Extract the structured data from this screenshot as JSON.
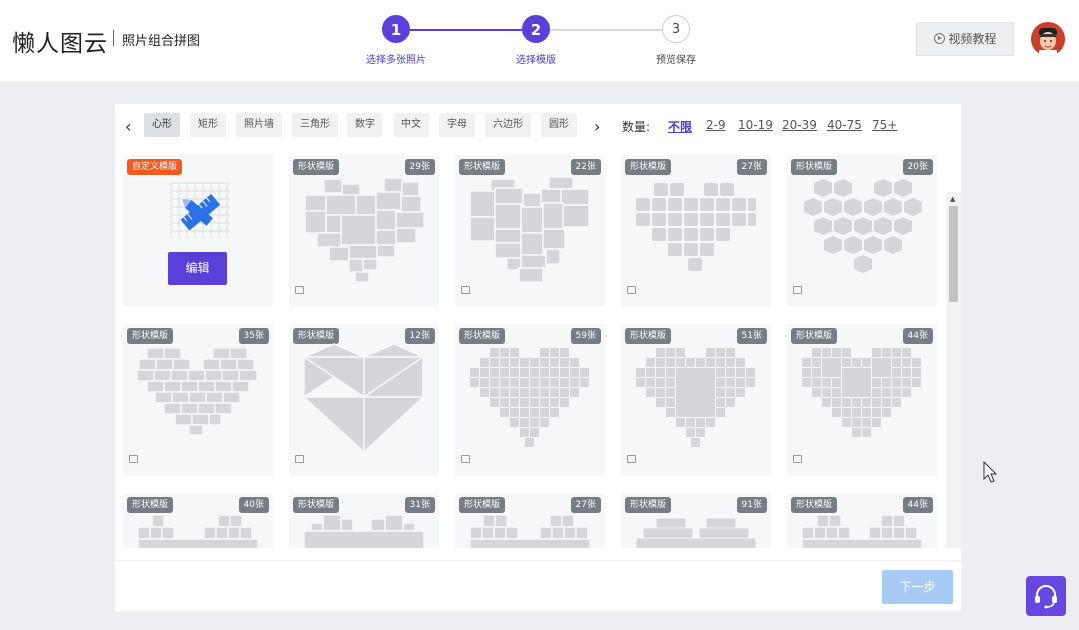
{
  "header": {
    "brand": "懒人图云",
    "subtitle": "照片组合拼图",
    "video_button": "视频教程",
    "steps": [
      {
        "number": "1",
        "label": "选择多张照片",
        "state": "done"
      },
      {
        "number": "2",
        "label": "选择模版",
        "state": "current"
      },
      {
        "number": "3",
        "label": "预览保存",
        "state": "todo"
      }
    ]
  },
  "toolbar": {
    "categories": [
      "心形",
      "矩形",
      "照片墙",
      "三角形",
      "数字",
      "中文",
      "字母",
      "六边形",
      "圆形"
    ],
    "active_category": "心形",
    "quantity_label": "数量:",
    "quantities": [
      "不限",
      "2-9",
      "10-19",
      "20-39",
      "40-75",
      "75+"
    ],
    "active_quantity": "不限"
  },
  "custom_card": {
    "badge": "自定义模版",
    "button": "编辑"
  },
  "templates": [
    {
      "badge": "形状模版",
      "count": "29张"
    },
    {
      "badge": "形状模版",
      "count": "22张"
    },
    {
      "badge": "形状模版",
      "count": "27张"
    },
    {
      "badge": "形状模版",
      "count": "20张"
    },
    {
      "badge": "形状模版",
      "count": "35张"
    },
    {
      "badge": "形状模版",
      "count": "12张"
    },
    {
      "badge": "形状模版",
      "count": "59张"
    },
    {
      "badge": "形状模版",
      "count": "51张"
    },
    {
      "badge": "形状模版",
      "count": "44张"
    },
    {
      "badge": "形状模版",
      "count": "40张"
    },
    {
      "badge": "形状模版",
      "count": "31张"
    },
    {
      "badge": "形状模版",
      "count": "27张"
    },
    {
      "badge": "形状模版",
      "count": "91张"
    },
    {
      "badge": "形状模版",
      "count": "44张"
    }
  ],
  "footer": {
    "next_button": "下一步"
  },
  "colors": {
    "accent": "#5b3fd9",
    "badge": "#777c85",
    "custom_badge": "#f25a1f",
    "next_disabled": "#a7cbf5"
  }
}
